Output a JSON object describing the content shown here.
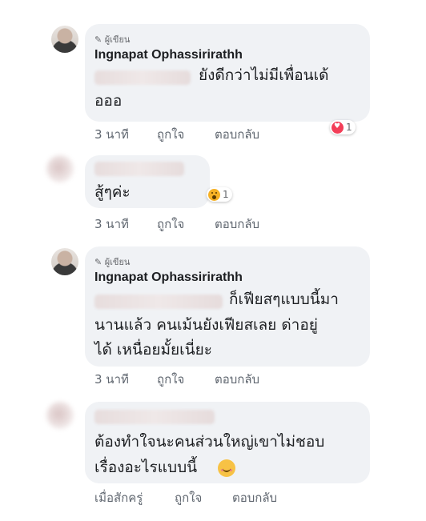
{
  "comments": [
    {
      "badge": "✎ ผู้เขียน",
      "name": "Ingnapat Ophassirirathh",
      "line1": "ยังดีกว่าไม่มีเพื่อนเด้",
      "line2": "อออ",
      "time": "3 นาที",
      "like": "ถูกใจ",
      "reply": "ตอบกลับ",
      "reaction_icon": "heart-icon",
      "reaction_count": "1"
    },
    {
      "line1": "สู้ๆค่ะ",
      "time": "3 นาที",
      "like": "ถูกใจ",
      "reply": "ตอบกลับ",
      "reaction_icon": "wow-icon",
      "reaction_count": "1"
    },
    {
      "badge": "✎ ผู้เขียน",
      "name": "Ingnapat Ophassirirathh",
      "line1": "ก็เฟียสๆแบบนี้มา",
      "line2": "นานแล้ว คนเม้นยังเฟียสเลย ด่าอยู่",
      "line3": "ได้ เหนื่อยมั้ยเนี่ยะ",
      "time": "3 นาที",
      "like": "ถูกใจ",
      "reply": "ตอบกลับ"
    },
    {
      "line1": "ต้องทำใจนะคนส่วนใหญ่เขาไม่ชอบ",
      "line2": "เรื่องอะไรแบบนี้",
      "emoji": "blushing-smile-emoji",
      "time": "เมื่อสักครู่",
      "like": "ถูกใจ",
      "reply": "ตอบกลับ"
    }
  ],
  "colors": {
    "bubble": "#f0f2f5",
    "heart": "#f33e58",
    "wow": "#f7b125",
    "meta_text": "#606770"
  }
}
